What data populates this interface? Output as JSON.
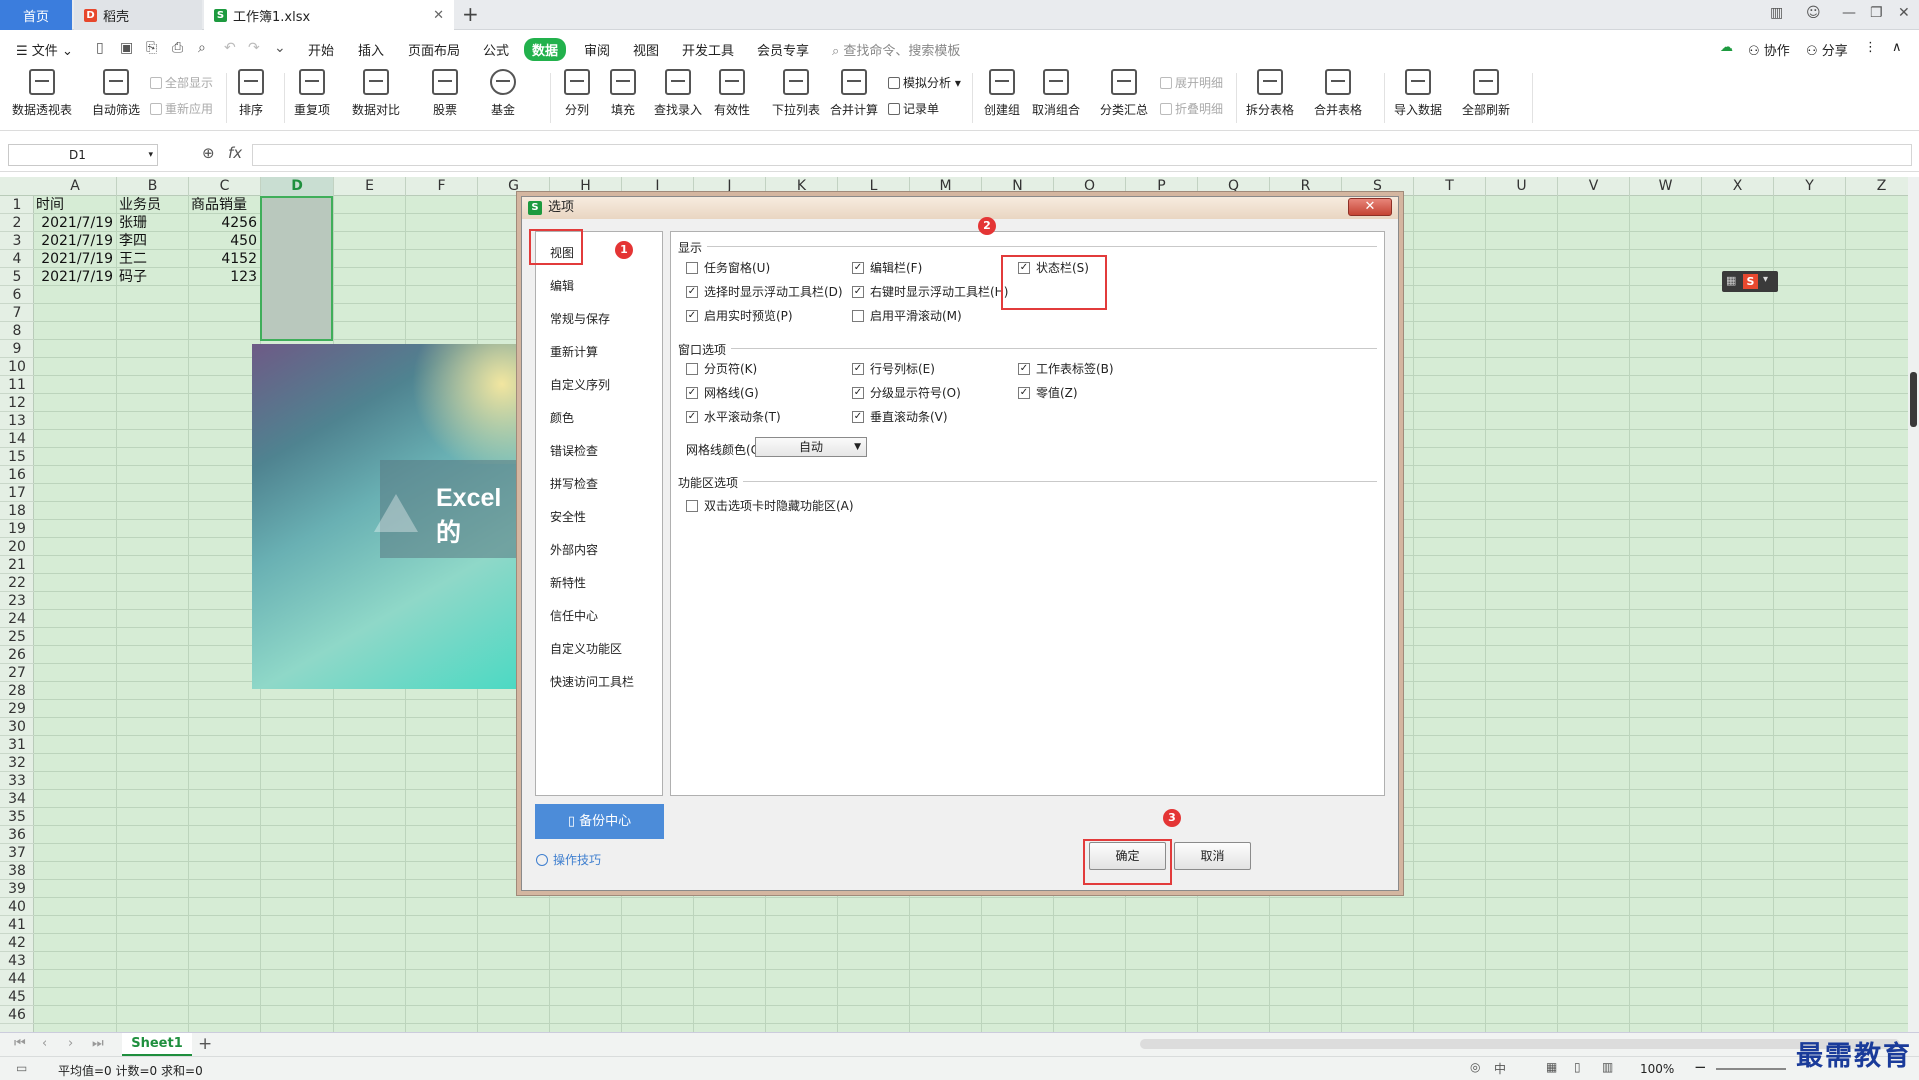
{
  "tabs": {
    "home": "首页",
    "daoke": "稻壳",
    "doc": "工作簿1.xlsx"
  },
  "menu": {
    "file": "文件",
    "items": [
      "开始",
      "插入",
      "页面布局",
      "公式",
      "数据",
      "审阅",
      "视图",
      "开发工具",
      "会员专享"
    ],
    "active": "数据",
    "search": "查找命令、搜索模板",
    "collab": "协作",
    "share": "分享"
  },
  "ribbon": {
    "big": [
      "数据透视表",
      "自动筛选",
      "排序",
      "重复项",
      "数据对比",
      "股票",
      "基金",
      "分列",
      "填充",
      "查找录入",
      "有效性",
      "下拉列表",
      "合并计算",
      "创建组",
      "取消组合",
      "分类汇总",
      "拆分表格",
      "合并表格",
      "导入数据",
      "全部刷新"
    ],
    "small": {
      "show_all": "全部显示",
      "reapply": "重新应用",
      "simulate": "模拟分析",
      "record": "记录单",
      "expand": "展开明细",
      "collapse": "折叠明细"
    }
  },
  "formula": {
    "namebox": "D1",
    "fx": "fx"
  },
  "columns": [
    "A",
    "B",
    "C",
    "D",
    "E",
    "F",
    "G",
    "H",
    "I",
    "J",
    "K",
    "L",
    "M",
    "N",
    "O",
    "P",
    "Q",
    "R",
    "S",
    "T",
    "U",
    "V",
    "W",
    "X",
    "Y",
    "Z"
  ],
  "rows": [
    "1",
    "2",
    "3",
    "4",
    "5",
    "6",
    "7",
    "8",
    "9",
    "10",
    "11",
    "12",
    "13",
    "14",
    "15",
    "16",
    "17",
    "18",
    "19",
    "20",
    "21",
    "22",
    "23",
    "24",
    "25",
    "26",
    "27",
    "28",
    "29",
    "30",
    "31",
    "32",
    "33",
    "34",
    "35",
    "36",
    "37",
    "38",
    "39",
    "40",
    "41",
    "42",
    "43",
    "44",
    "45",
    "46"
  ],
  "table": {
    "headers": [
      "时间",
      "业务员",
      "商品销量"
    ],
    "rows": [
      [
        "2021/7/19",
        "张珊",
        "4256"
      ],
      [
        "2021/7/19",
        "李四",
        "450"
      ],
      [
        "2021/7/19",
        "王二",
        "4152"
      ],
      [
        "2021/7/19",
        "码子",
        "123"
      ]
    ]
  },
  "picture": {
    "title": "Excel的"
  },
  "dialog": {
    "title": "选项",
    "nav": [
      "视图",
      "编辑",
      "常规与保存",
      "重新计算",
      "自定义序列",
      "颜色",
      "错误检查",
      "拼写检查",
      "安全性",
      "外部内容",
      "新特性",
      "信任中心",
      "自定义功能区",
      "快速访问工具栏"
    ],
    "sections": {
      "display": "显示",
      "window": "窗口选项",
      "ribbon": "功能区选项"
    },
    "display_opts": [
      {
        "label": "任务窗格(U)",
        "checked": false
      },
      {
        "label": "编辑栏(F)",
        "checked": true
      },
      {
        "label": "状态栏(S)",
        "checked": true
      },
      {
        "label": "选择时显示浮动工具栏(D)",
        "checked": true
      },
      {
        "label": "右键时显示浮动工具栏(H)",
        "checked": true
      },
      {
        "label": "启用实时预览(P)",
        "checked": true
      },
      {
        "label": "启用平滑滚动(M)",
        "checked": false
      }
    ],
    "window_opts": [
      {
        "label": "分页符(K)",
        "checked": false
      },
      {
        "label": "行号列标(E)",
        "checked": true
      },
      {
        "label": "工作表标签(B)",
        "checked": true
      },
      {
        "label": "网格线(G)",
        "checked": true
      },
      {
        "label": "分级显示符号(O)",
        "checked": true
      },
      {
        "label": "零值(Z)",
        "checked": true
      },
      {
        "label": "水平滚动条(T)",
        "checked": true
      },
      {
        "label": "垂直滚动条(V)",
        "checked": true
      }
    ],
    "gridcolor_label": "网格线颜色(C):",
    "gridcolor_value": "自动",
    "ribbon_opts": [
      {
        "label": "双击选项卡时隐藏功能区(A)",
        "checked": false
      }
    ],
    "backup": "备份中心",
    "tips": "操作技巧",
    "ok": "确定",
    "cancel": "取消",
    "badges": [
      "1",
      "2",
      "3"
    ]
  },
  "sheet": {
    "name": "Sheet1"
  },
  "status": {
    "text": "平均值=0 计数=0 求和=0",
    "zoom": "100%"
  },
  "watermark": "最需教育",
  "colors": {
    "accent": "#22b14c",
    "grid": "#d6ecd5",
    "highlight": "#e23b3b",
    "badge": "#e43535"
  }
}
